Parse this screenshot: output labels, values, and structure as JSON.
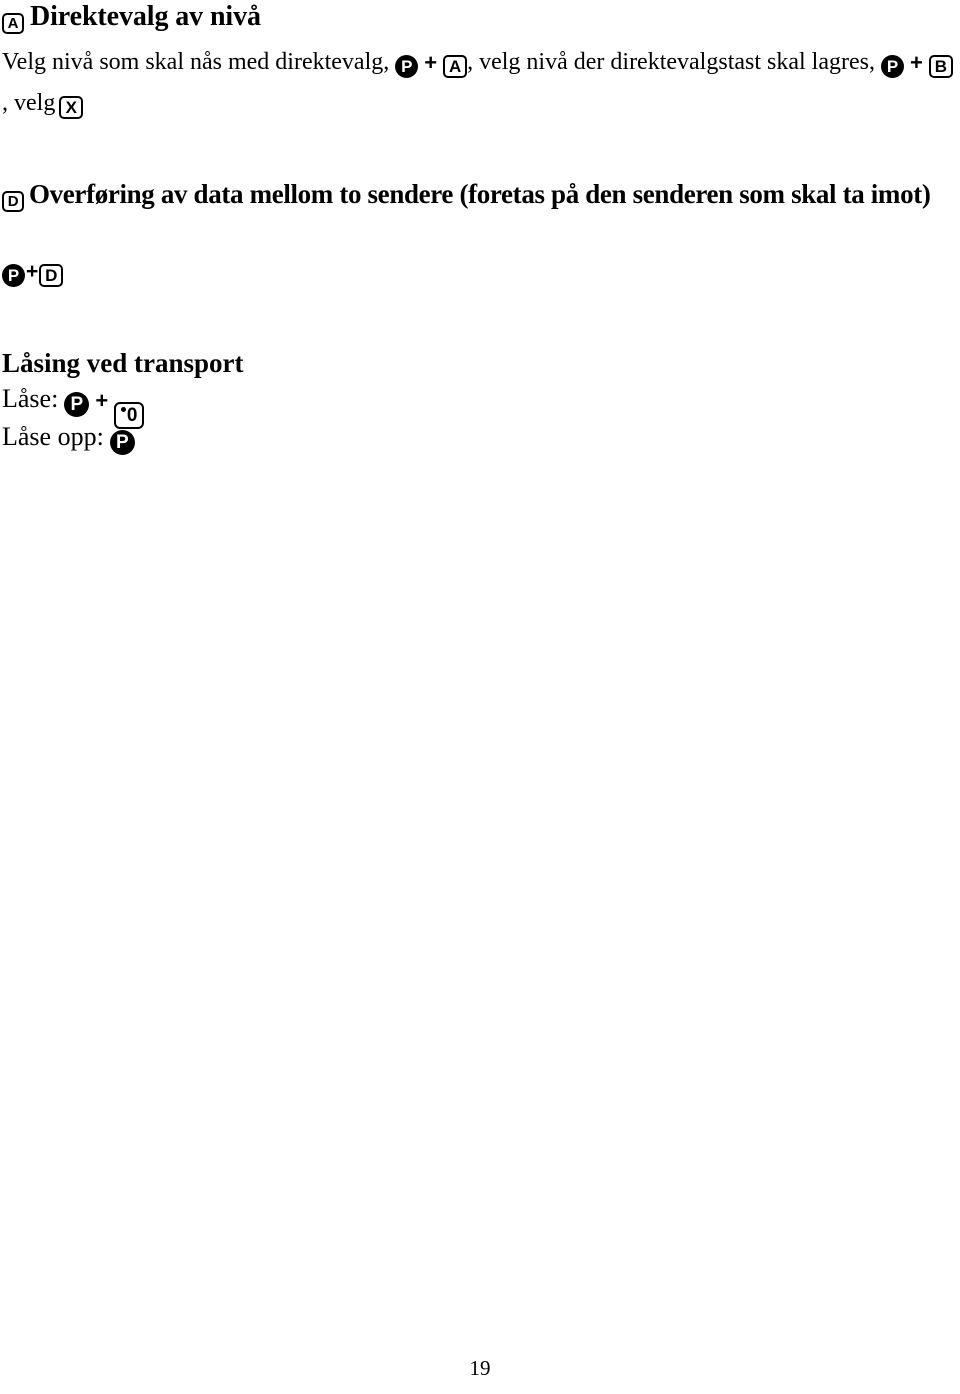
{
  "document": {
    "language": "Norwegian",
    "page_number": "19",
    "background_color": "#ffffff",
    "text_color": "#000000"
  },
  "section_direct_selection": {
    "heading_key": "A",
    "heading_text": "Direktevalg av nivå",
    "body": {
      "part1": "Velg nivå som skal nås med direktevalg,",
      "key_p_1": "P",
      "plus_1": "+",
      "key_a": "A",
      "part2": ", velg nivå der direktevalgstast skal lagres,",
      "key_p_2": "P",
      "plus_2": "+",
      "key_b": "B",
      "part3": ", velg",
      "key_x": "X"
    }
  },
  "section_data_transfer": {
    "heading_key": "D",
    "heading_text": "Overføring av data mellom to sendere (foretas på den senderen som skal ta imot)",
    "shortcut": {
      "key_p": "P",
      "plus": "+",
      "key_d": "D"
    }
  },
  "section_transport_lock": {
    "heading_text": "Låsing ved transport",
    "lock": {
      "label": "Låse:",
      "key_p": "P",
      "plus": "+",
      "key_zero": "0",
      "key_zero_has_dot": true
    },
    "unlock": {
      "label": "Låse opp:",
      "key_p": "P"
    }
  },
  "footer": {
    "page_number": "19"
  }
}
